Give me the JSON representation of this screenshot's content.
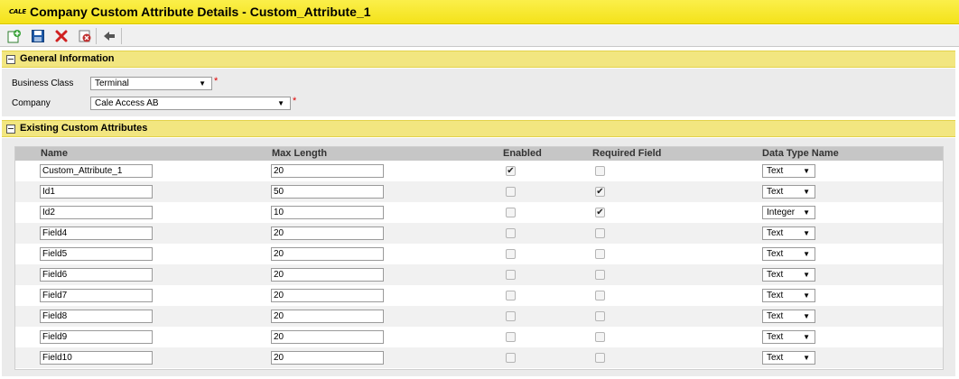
{
  "window": {
    "logo_text": "CALE",
    "title": "Company Custom Attribute Details - Custom_Attribute_1"
  },
  "toolbar": {
    "buttons": [
      {
        "name": "new-icon",
        "color": "#2e8b2e"
      },
      {
        "name": "save-icon",
        "color": "#1f5aa8"
      },
      {
        "name": "delete-icon",
        "color": "#d02020"
      },
      {
        "name": "undo-icon",
        "color": "#c03030"
      },
      {
        "name": "back-icon",
        "color": "#555555"
      }
    ]
  },
  "general": {
    "header": "General Information",
    "business_class_label": "Business Class",
    "business_class_value": "Terminal",
    "company_label": "Company",
    "company_value": "Cale Access AB",
    "required_mark": "*"
  },
  "existing": {
    "header": "Existing Custom Attributes",
    "columns": {
      "name": "Name",
      "max_length": "Max Length",
      "enabled": "Enabled",
      "required": "Required Field",
      "data_type": "Data Type Name"
    },
    "rows": [
      {
        "name": "Custom_Attribute_1",
        "max_length": "20",
        "enabled": true,
        "required": false,
        "data_type": "Text"
      },
      {
        "name": "Id1",
        "max_length": "50",
        "enabled": false,
        "required": true,
        "data_type": "Text"
      },
      {
        "name": "Id2",
        "max_length": "10",
        "enabled": false,
        "required": true,
        "data_type": "Integer"
      },
      {
        "name": "Field4",
        "max_length": "20",
        "enabled": false,
        "required": false,
        "data_type": "Text"
      },
      {
        "name": "Field5",
        "max_length": "20",
        "enabled": false,
        "required": false,
        "data_type": "Text"
      },
      {
        "name": "Field6",
        "max_length": "20",
        "enabled": false,
        "required": false,
        "data_type": "Text"
      },
      {
        "name": "Field7",
        "max_length": "20",
        "enabled": false,
        "required": false,
        "data_type": "Text"
      },
      {
        "name": "Field8",
        "max_length": "20",
        "enabled": false,
        "required": false,
        "data_type": "Text"
      },
      {
        "name": "Field9",
        "max_length": "20",
        "enabled": false,
        "required": false,
        "data_type": "Text"
      },
      {
        "name": "Field10",
        "max_length": "20",
        "enabled": false,
        "required": false,
        "data_type": "Text"
      }
    ]
  },
  "colors": {
    "title_yellow": "#f4e21a",
    "section_yellow": "#f2e680",
    "required_red": "#dd0000"
  }
}
